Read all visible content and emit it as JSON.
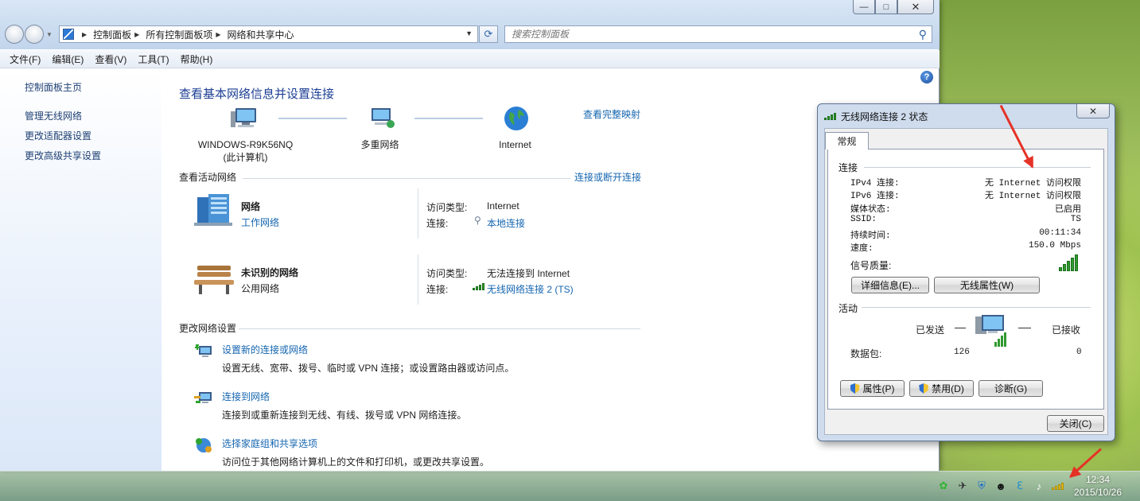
{
  "window": {
    "breadcrumbs": [
      "控制面板",
      "所有控制面板项",
      "网络和共享中心"
    ],
    "search_placeholder": "搜索控制面板"
  },
  "menu": [
    "文件(F)",
    "编辑(E)",
    "查看(V)",
    "工具(T)",
    "帮助(H)"
  ],
  "sidebar": {
    "items": [
      "控制面板主页",
      "管理无线网络",
      "更改适配器设置",
      "更改高级共享设置"
    ]
  },
  "main": {
    "title": "查看基本网络信息并设置连接",
    "full_map_link": "查看完整映射",
    "map": {
      "computer_name": "WINDOWS-R9K56NQ",
      "computer_sub": "(此计算机)",
      "multi": "多重网络",
      "internet": "Internet"
    },
    "active_header": "查看活动网络",
    "connect_link": "连接或断开连接",
    "networks": [
      {
        "name": "网络",
        "type_link": "工作网络",
        "access_label": "访问类型:",
        "access": "Internet",
        "conn_label": "连接:",
        "conn": "本地连接"
      },
      {
        "name": "未识别的网络",
        "type": "公用网络",
        "access_label": "访问类型:",
        "access": "无法连接到 Internet",
        "conn_label": "连接:",
        "conn": "无线网络连接 2 (TS)"
      }
    ],
    "change_header": "更改网络设置",
    "tasks": [
      {
        "title": "设置新的连接或网络",
        "desc": "设置无线、宽带、拨号、临时或 VPN 连接；或设置路由器或访问点。"
      },
      {
        "title": "连接到网络",
        "desc": "连接到或重新连接到无线、有线、拨号或 VPN 网络连接。"
      },
      {
        "title": "选择家庭组和共享选项",
        "desc": "访问位于其他网络计算机上的文件和打印机，或更改共享设置。"
      }
    ]
  },
  "dialog": {
    "title": "无线网络连接 2 状态",
    "tab": "常规",
    "connection_group": "连接",
    "rows": [
      {
        "label": "IPv4 连接:",
        "value": "无 Internet 访问权限"
      },
      {
        "label": "IPv6 连接:",
        "value": "无 Internet 访问权限"
      },
      {
        "label": "媒体状态:",
        "value": "已启用"
      },
      {
        "label": "SSID:",
        "value": "TS"
      },
      {
        "label": "持续时间:",
        "value": "00:11:34"
      },
      {
        "label": "速度:",
        "value": "150.0 Mbps"
      }
    ],
    "signal_label": "信号质量:",
    "btn_details": "详细信息(E)...",
    "btn_wireless": "无线属性(W)",
    "activity_group": "活动",
    "sent_label": "已发送",
    "received_label": "已接收",
    "packets_label": "数据包:",
    "packets_sent": "126",
    "packets_received": "0",
    "btn_properties": "属性(P)",
    "btn_disable": "禁用(D)",
    "btn_diagnose": "诊断(G)",
    "btn_close": "关闭(C)"
  },
  "clock": {
    "time": "12:34",
    "date": "2015/10/26"
  },
  "colors": {
    "link": "#1566b0",
    "title": "#1c3f94",
    "annotation_arrow": "#e53226"
  }
}
